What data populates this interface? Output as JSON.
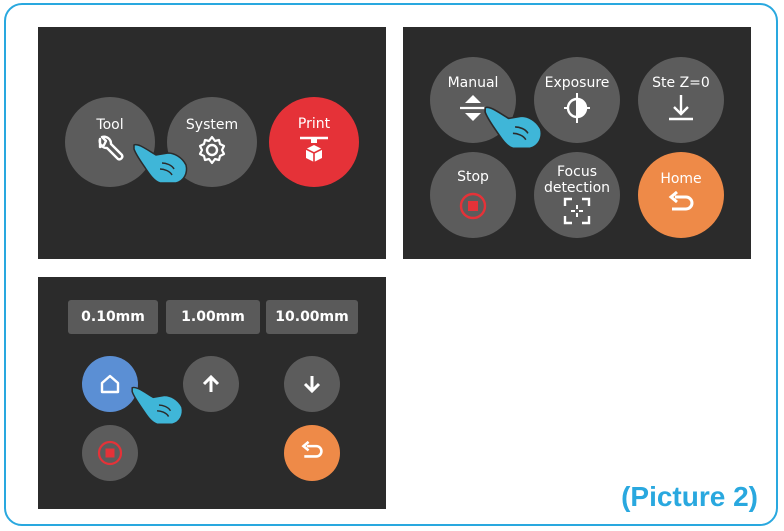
{
  "panel_main": {
    "tool_label": "Tool",
    "system_label": "System",
    "print_label": "Print"
  },
  "panel_tool": {
    "manual_label": "Manual",
    "exposure_label": "Exposure",
    "set_z_label": "Ste Z=0",
    "stop_label": "Stop",
    "focus_label_line1": "Focus",
    "focus_label_line2": "detection",
    "home_label": "Home"
  },
  "panel_manual": {
    "steps": [
      "0.10mm",
      "1.00mm",
      "10.00mm"
    ]
  },
  "caption": "(Picture 2)",
  "colors": {
    "frame": "#29a8df",
    "panel_bg": "#2b2b2b",
    "button_gray": "#5c5c5c",
    "print_red": "#e53238",
    "home_orange": "#ee8a48",
    "home_blue": "#5b8fd4",
    "hand_cyan": "#3fb6d8"
  },
  "icons": [
    "wrench-icon",
    "gear-icon",
    "print-icon",
    "up-down-arrows-icon",
    "exposure-icon",
    "set-z-icon",
    "stop-icon",
    "focus-icon",
    "back-icon",
    "home-icon",
    "arrow-up-icon",
    "arrow-down-icon",
    "pointing-hand-icon"
  ]
}
